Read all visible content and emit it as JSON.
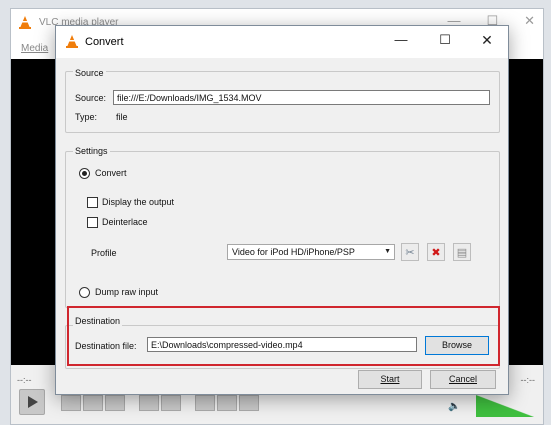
{
  "vlc": {
    "title": "VLC media player",
    "menu_media": "Media",
    "time_left": "--:--",
    "time_right": "--:--"
  },
  "dialog": {
    "title": "Convert",
    "source": {
      "group_title": "Source",
      "source_label": "Source:",
      "source_value": "file:///E:/Downloads/IMG_1534.MOV",
      "type_label": "Type:",
      "type_value": "file"
    },
    "settings": {
      "group_title": "Settings",
      "convert_label": "Convert",
      "display_output_label": "Display the output",
      "deinterlace_label": "Deinterlace",
      "profile_label": "Profile",
      "profile_value": "Video for iPod HD/iPhone/PSP",
      "dump_raw_label": "Dump raw input"
    },
    "destination": {
      "group_title": "Destination",
      "file_label": "Destination file:",
      "file_value": "E:\\Downloads\\compressed-video.mp4",
      "browse_label": "Browse"
    },
    "start_label": "Start",
    "cancel_label": "Cancel"
  },
  "colors": {
    "highlight": "#d0262e",
    "accent": "#0078d7",
    "vlc_orange": "#f07d0b"
  }
}
